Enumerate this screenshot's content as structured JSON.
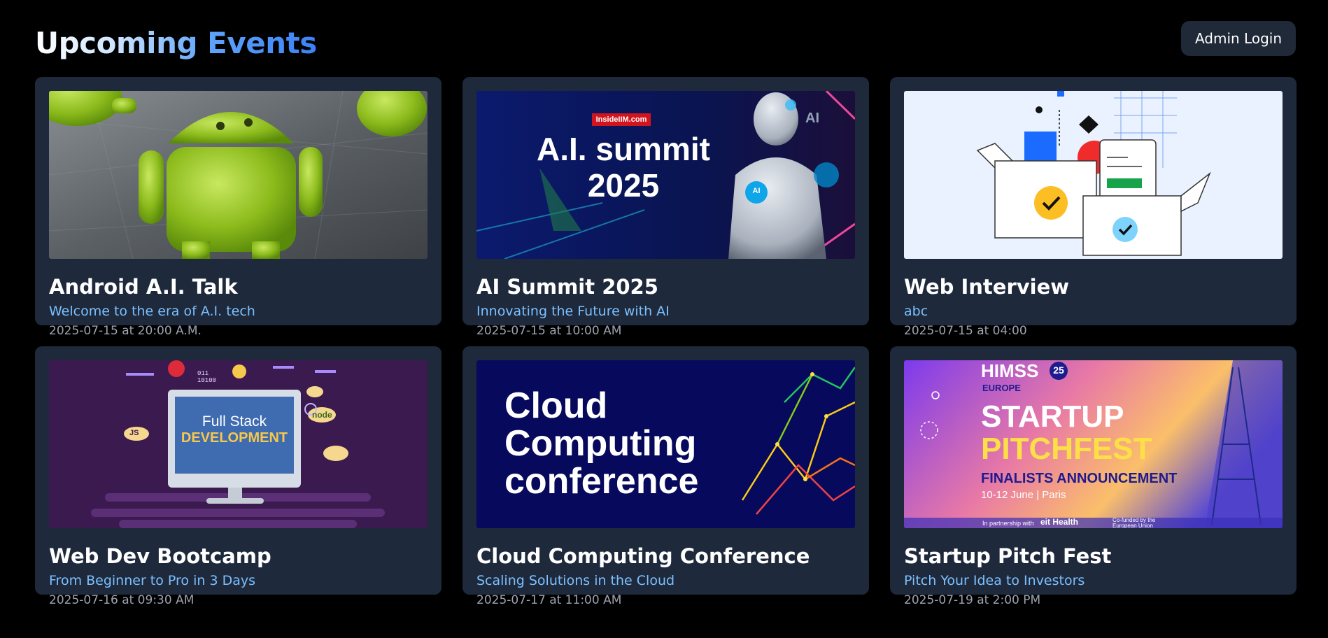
{
  "header": {
    "title": "Upcoming Events",
    "admin_button": "Admin Login"
  },
  "events": [
    {
      "title": "Android A.I. Talk",
      "subtitle": "Welcome to the era of A.I. tech",
      "date": "2025-07-15 at 20:00 A.M.",
      "image_icon": "android-robot-image"
    },
    {
      "title": "AI Summit 2025",
      "subtitle": "Innovating the Future with AI",
      "date": "2025-07-15 at 10:00 AM",
      "image_icon": "ai-robot-banner-image",
      "banner": {
        "badge": "InsideIIM.com",
        "line1": "A.I. summit",
        "line2": "2025",
        "chip": "AI",
        "corner": "AI"
      }
    },
    {
      "title": "Web Interview",
      "subtitle": "abc",
      "date": "2025-07-15 at 04:00",
      "image_icon": "boxes-illustration-image"
    },
    {
      "title": "Web Dev Bootcamp",
      "subtitle": "From Beginner to Pro in 3 Days",
      "date": "2025-07-16 at 09:30 AM",
      "image_icon": "full-stack-monitor-image",
      "banner": {
        "line1": "Full Stack",
        "line2": "DEVELOPMENT",
        "js": "JS",
        "node": "node",
        "bits": "011\n10100"
      }
    },
    {
      "title": "Cloud Computing Conference",
      "subtitle": "Scaling Solutions in the Cloud",
      "date": "2025-07-17 at 11:00 AM",
      "image_icon": "cloud-network-banner-image",
      "banner": {
        "line1": "Cloud",
        "line2": "Computing",
        "line3": "conference"
      }
    },
    {
      "title": "Startup Pitch Fest",
      "subtitle": "Pitch Your Idea to Investors",
      "date": "2025-07-19 at 2:00 PM",
      "image_icon": "pitchfest-banner-image",
      "banner": {
        "brand": "HIMSS",
        "year": "25",
        "region": "EUROPE",
        "line1": "STARTUP",
        "line2": "PITCHFEST",
        "line3": "FINALISTS ANNOUNCEMENT",
        "line4": "10-12 June | Paris",
        "partner": "In partnership with",
        "eit": "eit Health",
        "eu": "Co-funded by the European Union"
      }
    }
  ],
  "colors": {
    "background": "#000000",
    "card": "#1e293b",
    "subtitle": "#7cc0ff",
    "date": "#9ca3af",
    "button": "#1f2937"
  }
}
